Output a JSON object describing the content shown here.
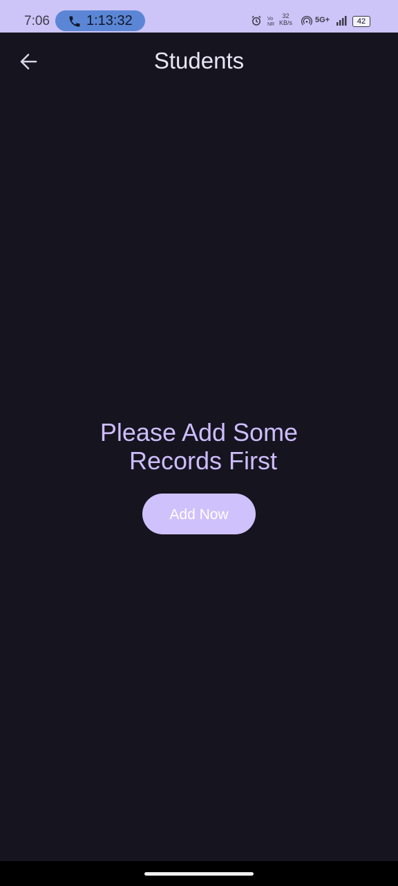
{
  "status_bar": {
    "time": "7:06",
    "call_timer": "1:13:32",
    "network_speed_value": "32",
    "network_speed_unit": "KB/s",
    "network_type": "5G+",
    "battery": "42",
    "icons": [
      "phone-icon",
      "alarm-icon",
      "vonr-icon",
      "hotspot-icon",
      "signal-icon",
      "battery-icon"
    ]
  },
  "app_bar": {
    "title": "Students",
    "back_icon": "arrow-left-icon"
  },
  "empty_state": {
    "message_line1": "Please Add Some",
    "message_line2": "Records First",
    "button_label": "Add Now"
  },
  "colors": {
    "background": "#16141f",
    "status_bar": "#cdc4f8",
    "accent": "#cdbdfb",
    "call_pill": "#5b86d6"
  }
}
